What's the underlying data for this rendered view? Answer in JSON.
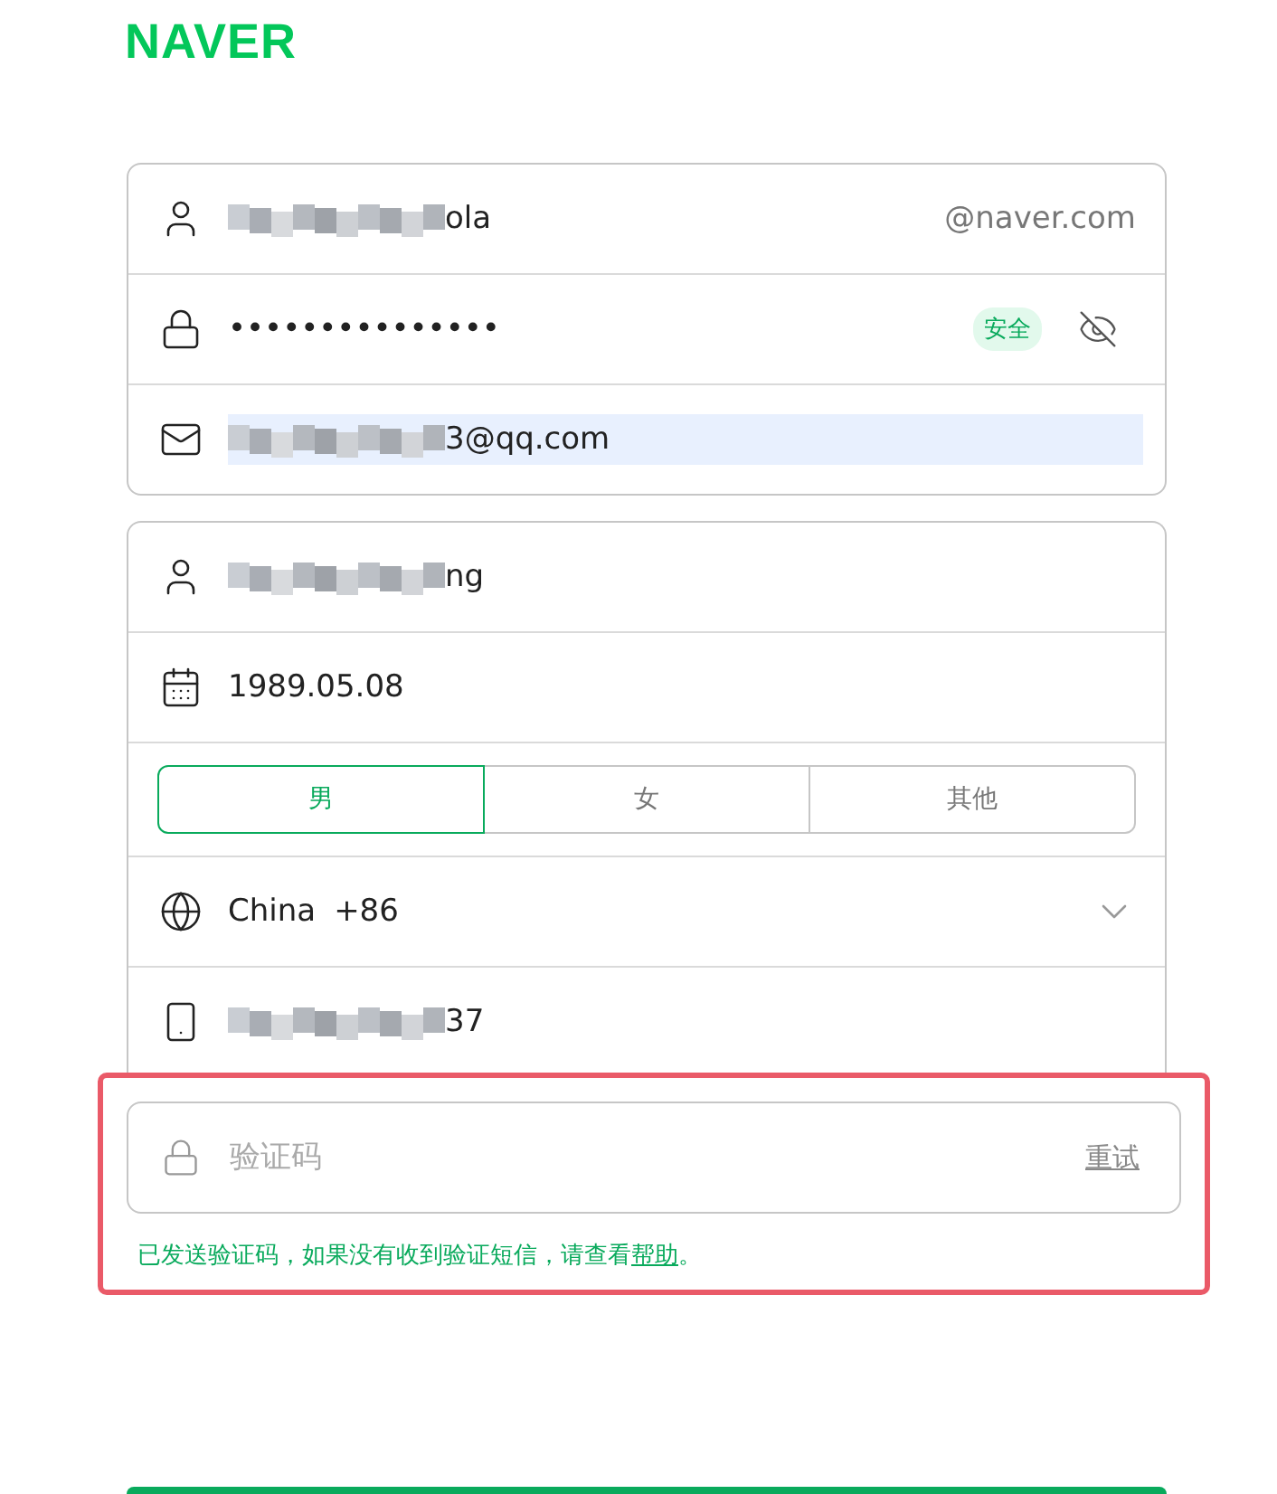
{
  "logo": "NAVER",
  "account": {
    "id": {
      "value": "ola",
      "blurred": true,
      "suffix": "@naver.com"
    },
    "password": {
      "value": "•••••••••••••••",
      "badge": "安全"
    },
    "email": {
      "value": "3@qq.com",
      "blurred": true,
      "highlighted": true
    }
  },
  "profile": {
    "name": {
      "value": "ng",
      "blurred": true
    },
    "birthday": {
      "value": "1989.05.08"
    },
    "gender": [
      {
        "label": "男",
        "selected": true
      },
      {
        "label": "女",
        "selected": false
      },
      {
        "label": "其他",
        "selected": false
      }
    ],
    "country": {
      "name": "China",
      "code": "+86"
    },
    "phone": {
      "value": "37",
      "blurred": true
    }
  },
  "verification": {
    "highlighted": true,
    "placeholder": "验证码",
    "retry": "重试",
    "message_before": "已发送验证码，如果没有收到验证短信，请查看",
    "link": "帮助",
    "message_after": "。"
  }
}
